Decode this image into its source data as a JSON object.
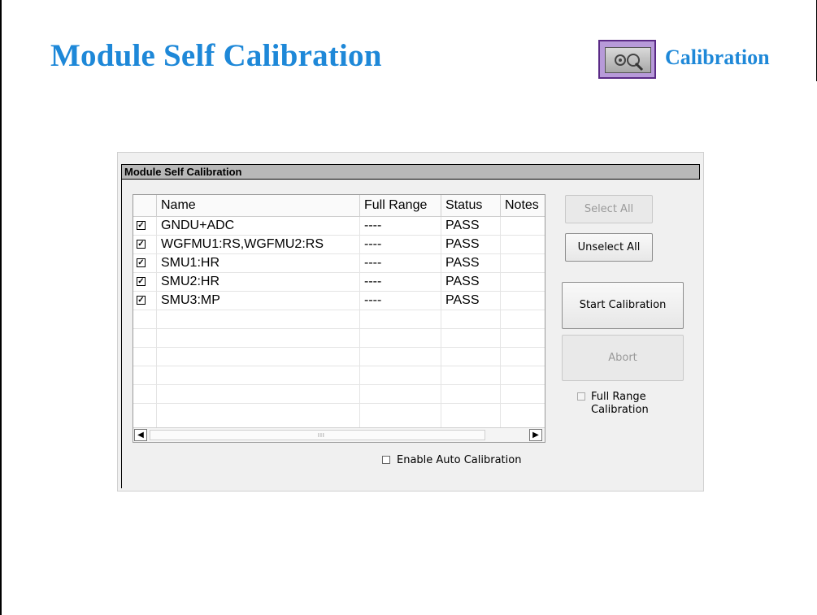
{
  "slide": {
    "title": "Module Self Calibration",
    "calibration_label": "Calibration"
  },
  "dialog": {
    "title": "Module Self Calibration",
    "columns": [
      "Name",
      "Full Range",
      "Status",
      "Notes"
    ],
    "rows": [
      {
        "checked": true,
        "name": "GNDU+ADC",
        "full_range": "----",
        "status": "PASS",
        "notes": ""
      },
      {
        "checked": true,
        "name": "WGFMU1:RS,WGFMU2:RS",
        "full_range": "----",
        "status": "PASS",
        "notes": ""
      },
      {
        "checked": true,
        "name": "SMU1:HR",
        "full_range": "----",
        "status": "PASS",
        "notes": ""
      },
      {
        "checked": true,
        "name": "SMU2:HR",
        "full_range": "----",
        "status": "PASS",
        "notes": ""
      },
      {
        "checked": true,
        "name": "SMU3:MP",
        "full_range": "----",
        "status": "PASS",
        "notes": ""
      }
    ],
    "empty_rows": 5,
    "buttons": {
      "select_all": "Select All",
      "unselect_all": "Unselect All",
      "start_calibration": "Start Calibration",
      "abort": "Abort"
    },
    "full_range_calibration": {
      "line1": "Full Range",
      "line2": "Calibration",
      "checked": false
    },
    "enable_auto_calibration": {
      "label": "Enable Auto Calibration",
      "checked": false
    },
    "scroll_grip": "III"
  },
  "colors": {
    "title_blue": "#1e88d8",
    "icon_purple": "#b79ad9"
  }
}
